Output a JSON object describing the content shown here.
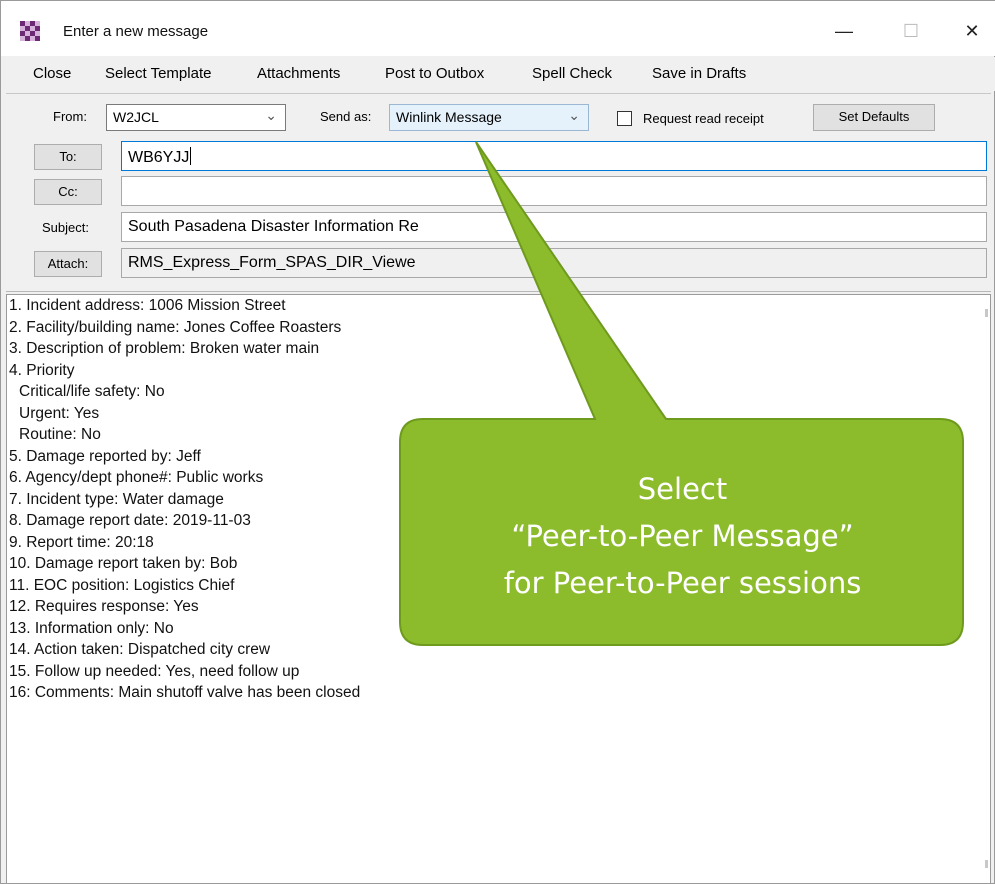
{
  "window": {
    "title": "Enter a new message",
    "minimize_symbol": "—",
    "maximize_symbol": "☐",
    "close_symbol": "✕"
  },
  "menu": [
    "Close",
    "Select Template",
    "Attachments",
    "Post to Outbox",
    "Spell Check",
    "Save in Drafts"
  ],
  "header": {
    "from_label": "From:",
    "from_value": "W2JCL",
    "send_as_label": "Send as:",
    "send_as_value": "Winlink Message",
    "read_receipt_label": "Request read receipt",
    "read_receipt_checked": false,
    "set_defaults_label": "Set Defaults",
    "to_button": "To:",
    "to_value": "WB6YJJ",
    "cc_button": "Cc:",
    "cc_value": "",
    "subject_label": "Subject:",
    "subject_value": "South Pasadena Disaster Information Re",
    "attach_button": "Attach:",
    "attach_value": "RMS_Express_Form_SPAS_DIR_Viewe"
  },
  "body_lines": [
    "1. Incident address: 1006 Mission Street",
    "2. Facility/building name: Jones Coffee Roasters",
    "3. Description of problem: Broken water main",
    "4. Priority",
    "  Critical/life safety: No",
    "  Urgent: Yes",
    "  Routine: No",
    "5. Damage reported by: Jeff",
    "6. Agency/dept phone#: Public works",
    "7. Incident type: Water damage",
    "8. Damage report date: 2019-11-03",
    "9. Report time: 20:18",
    "10. Damage report taken by: Bob",
    "11. EOC position: Logistics Chief",
    "12. Requires response: Yes",
    "13. Information only: No",
    "14. Action taken: Dispatched city crew",
    "15. Follow up needed: Yes, need follow up",
    "16: Comments: Main shutoff valve has been closed"
  ],
  "callout": {
    "lines": [
      "Select",
      "“Peer-to-Peer Message”",
      "for Peer-to-Peer sessions"
    ],
    "fill_color": "#8cbb2b",
    "border_color": "#6e9a1e"
  },
  "icons": {
    "app": "winlink-checker-icon",
    "combo_arrow": "chevron-down-icon"
  }
}
